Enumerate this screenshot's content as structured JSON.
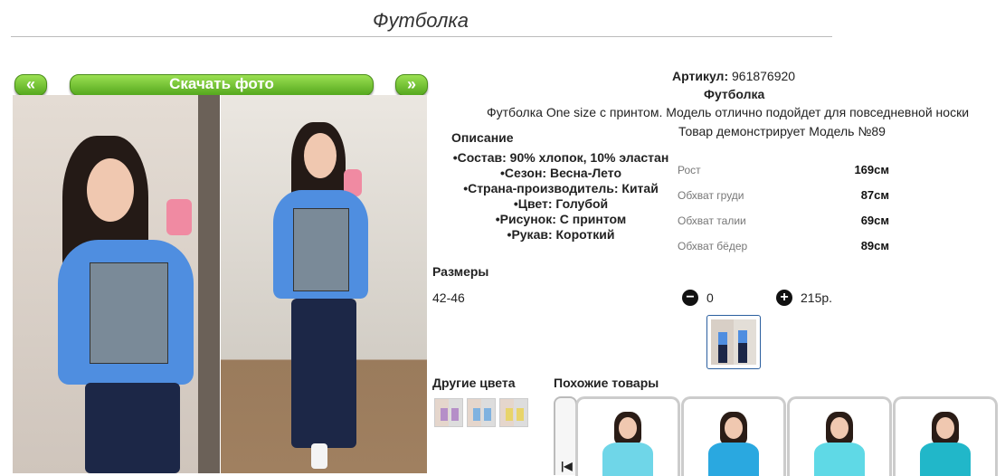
{
  "page": {
    "title": "Футболка"
  },
  "nav": {
    "prev_label": "«",
    "download_label": "Скачать фото",
    "next_label": "»"
  },
  "product": {
    "article_label": "Артикул:",
    "article_value": "961876920",
    "name": "Футболка",
    "description": "Футболка One size с принтом. Модель отлично подойдет для повседневной носки",
    "model_note": "Товар демонстрирует Модель №89"
  },
  "details": {
    "heading": "Описание",
    "items": [
      "Состав: 90% хлопок, 10% эластан",
      "Сезон: Весна-Лето",
      "Страна-производитель: Китай",
      "Цвет: Голубой",
      "Рисунок: С принтом",
      "Рукав: Короткий"
    ]
  },
  "measurements": [
    {
      "label": "Рост",
      "value": "169см"
    },
    {
      "label": "Обхват груди",
      "value": "87см"
    },
    {
      "label": "Обхват талии",
      "value": "69см"
    },
    {
      "label": "Обхват бёдер",
      "value": "89см"
    }
  ],
  "sizes": {
    "heading": "Размеры",
    "row": {
      "size": "42-46",
      "minus": "−",
      "quantity": "0",
      "plus": "+",
      "price": "215р."
    }
  },
  "other_colors": {
    "heading": "Другие цвета",
    "swatches": [
      "#b58fc8",
      "#7fb2e0",
      "#e8d46a"
    ]
  },
  "similar": {
    "heading": "Похожие товары",
    "arrow": "|◀",
    "shirt_colors": [
      "#6fd6e8",
      "#2aa8e0",
      "#5fd9e6",
      "#21b7c9"
    ]
  }
}
